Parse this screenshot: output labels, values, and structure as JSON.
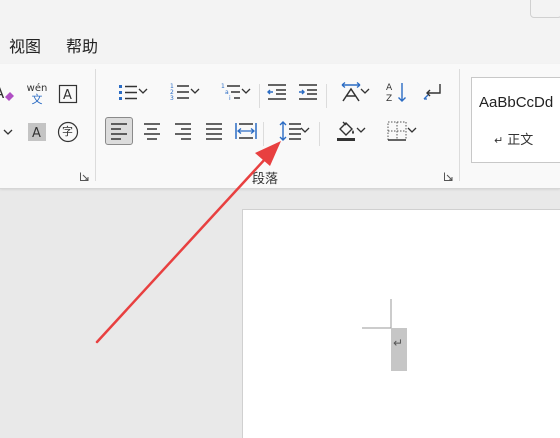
{
  "tabs": [
    {
      "label": "视图"
    },
    {
      "label": "帮助"
    }
  ],
  "font_group": {
    "phonetic_guide": {
      "top": "wén",
      "bottom": "文"
    },
    "enclose_char": "字"
  },
  "paragraph_group": {
    "label": "段落"
  },
  "styles_group": {
    "sample_text": "AaBbCcDd",
    "style_name": "正文",
    "style_mark": "↵"
  },
  "document": {
    "paragraph_mark": "↵"
  },
  "colors": {
    "annotation_arrow": "#e84040",
    "icon_blue": "#2b6cc4",
    "ribbon_bg": "#f9f9f9"
  }
}
